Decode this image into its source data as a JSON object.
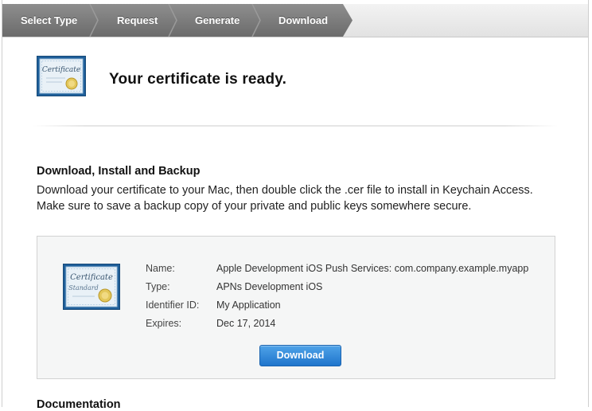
{
  "steps": [
    {
      "label": "Select Type"
    },
    {
      "label": "Request"
    },
    {
      "label": "Generate"
    },
    {
      "label": "Download"
    }
  ],
  "header": {
    "title": "Your certificate is ready.",
    "icon": "certificate-icon",
    "icon_text": "Certificate"
  },
  "section": {
    "heading": "Download, Install and Backup",
    "body": "Download your certificate to your Mac, then double click the .cer file to install in Keychain Access. Make sure to save a backup copy of your private and public keys somewhere secure."
  },
  "certificate": {
    "icon": "certificate-standard-icon",
    "icon_text_1": "Certificate",
    "icon_text_2": "Standard",
    "fields": [
      {
        "label": "Name:",
        "value": "Apple Development iOS Push Services: com.company.example.myapp"
      },
      {
        "label": "Type:",
        "value": "APNs Development iOS"
      },
      {
        "label": "Identifier ID:",
        "value": "My Application"
      },
      {
        "label": "Expires:",
        "value": "Dec 17, 2014"
      }
    ],
    "download_label": "Download"
  },
  "documentation": {
    "heading": "Documentation"
  },
  "colors": {
    "accent": "#1f75cc",
    "steps_active": "#7a7a7a"
  }
}
